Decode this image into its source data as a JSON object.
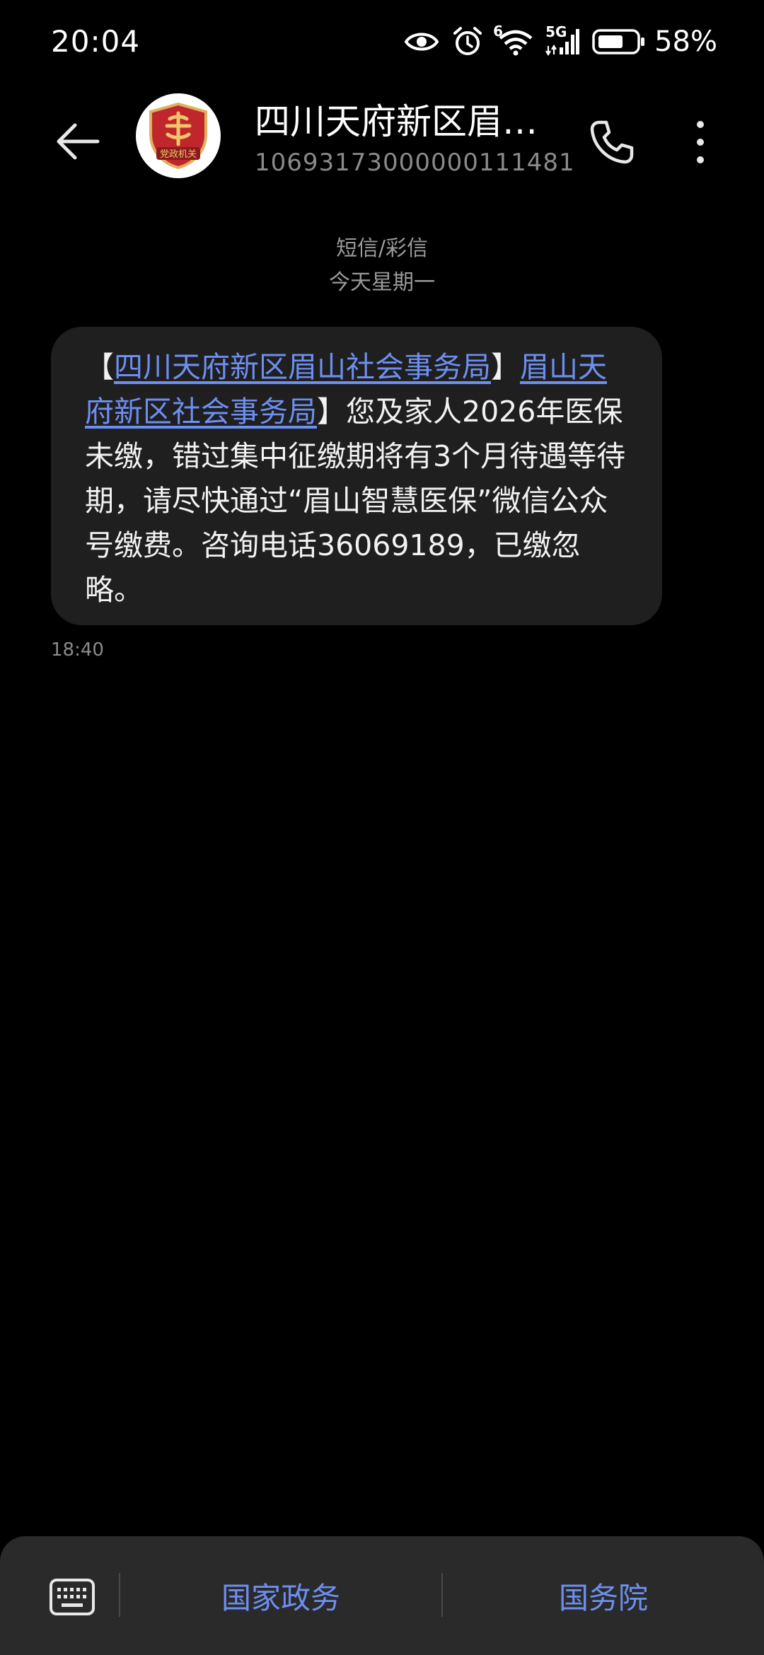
{
  "status_bar": {
    "time": "20:04",
    "network": "5G",
    "wifi_badge": "6",
    "battery": "58%",
    "icons": [
      "eye-icon",
      "alarm-icon",
      "wifi-icon",
      "signal-icon",
      "battery-icon"
    ]
  },
  "header": {
    "contact_name": "四川天府新区眉…",
    "contact_number": "10693173000000111481",
    "avatar_label": "党政机关",
    "icons": [
      "back-arrow-icon",
      "phone-icon",
      "more-vertical-icon"
    ]
  },
  "meta": {
    "message_type": "短信/彩信",
    "date": "今天星期一"
  },
  "message": {
    "bracket_open": "【",
    "link_1": "四川天府新区眉山社会事务局",
    "bracket_close": "】",
    "link_2": "眉山天府新区社会事务局",
    "bracket_close_2": "】",
    "body": "您及家人2026年医保未缴，错过集中征缴期将有3个月待遇等待期，请尽快通过“眉山智慧医保”微信公众号缴费。咨询电话36069189，已缴忽略。",
    "time": "18:40"
  },
  "bottom_menu": {
    "items": [
      "国家政务",
      "国务院"
    ]
  },
  "colors": {
    "background": "#000000",
    "bubble": "#1f1f1f",
    "link": "#6d8ff0",
    "bottom_bar": "#2a2a2a",
    "avatar_badge": "#c0272d"
  }
}
